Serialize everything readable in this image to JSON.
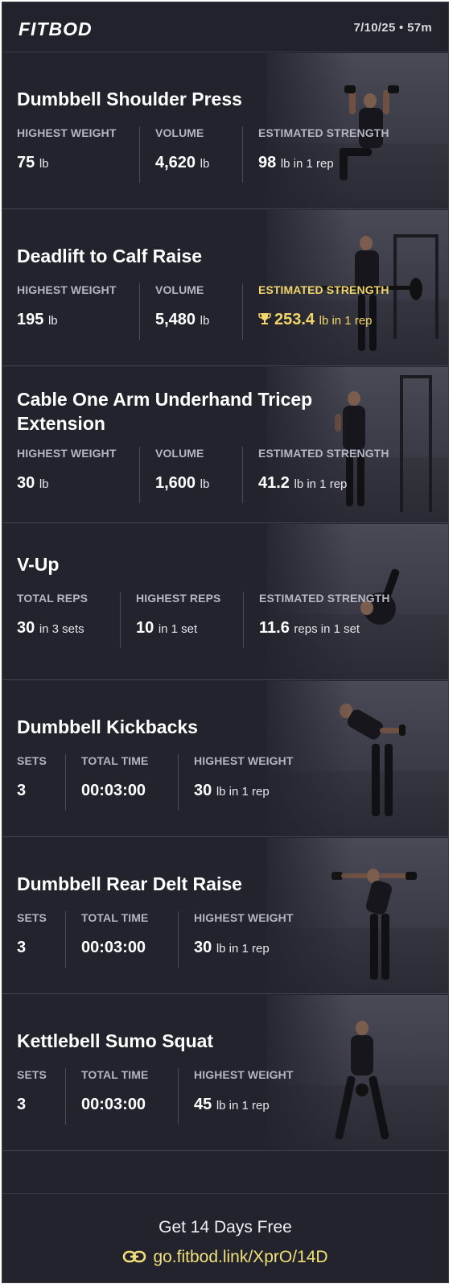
{
  "header": {
    "logo": "FITBOD",
    "meta": "7/10/25 • 57m"
  },
  "cards": [
    {
      "title": "Dumbbell Shoulder Press",
      "stats": [
        {
          "label": "HIGHEST WEIGHT",
          "value": "75",
          "unit": "lb"
        },
        {
          "label": "VOLUME",
          "value": "4,620",
          "unit": "lb"
        },
        {
          "label": "ESTIMATED STRENGTH",
          "value": "98",
          "unit": "lb in 1 rep"
        }
      ]
    },
    {
      "title": "Deadlift to Calf Raise",
      "stats": [
        {
          "label": "HIGHEST WEIGHT",
          "value": "195",
          "unit": "lb"
        },
        {
          "label": "VOLUME",
          "value": "5,480",
          "unit": "lb"
        },
        {
          "label": "ESTIMATED STRENGTH",
          "value": "253.4",
          "unit": "lb in 1 rep"
        }
      ]
    },
    {
      "title": "Cable One Arm Underhand Tricep Extension",
      "stats": [
        {
          "label": "HIGHEST WEIGHT",
          "value": "30",
          "unit": "lb"
        },
        {
          "label": "VOLUME",
          "value": "1,600",
          "unit": "lb"
        },
        {
          "label": "ESTIMATED STRENGTH",
          "value": "41.2",
          "unit": "lb in 1 rep"
        }
      ]
    },
    {
      "title": "V-Up",
      "stats": [
        {
          "label": "TOTAL REPS",
          "value": "30",
          "unit": "in 3 sets"
        },
        {
          "label": "HIGHEST REPS",
          "value": "10",
          "unit": "in 1 set"
        },
        {
          "label": "ESTIMATED STRENGTH",
          "value": "11.6",
          "unit": "reps in 1 set"
        }
      ]
    },
    {
      "title": "Dumbbell Kickbacks",
      "stats": [
        {
          "label": "SETS",
          "value": "3",
          "unit": ""
        },
        {
          "label": "TOTAL TIME",
          "value": "00:03:00",
          "unit": ""
        },
        {
          "label": "HIGHEST WEIGHT",
          "value": "30",
          "unit": "lb in 1 rep"
        }
      ]
    },
    {
      "title": "Dumbbell Rear Delt Raise",
      "stats": [
        {
          "label": "SETS",
          "value": "3",
          "unit": ""
        },
        {
          "label": "TOTAL TIME",
          "value": "00:03:00",
          "unit": ""
        },
        {
          "label": "HIGHEST WEIGHT",
          "value": "30",
          "unit": "lb in 1 rep"
        }
      ]
    },
    {
      "title": "Kettlebell Sumo Squat",
      "stats": [
        {
          "label": "SETS",
          "value": "3",
          "unit": ""
        },
        {
          "label": "TOTAL TIME",
          "value": "00:03:00",
          "unit": ""
        },
        {
          "label": "HIGHEST WEIGHT",
          "value": "45",
          "unit": "lb in 1 rep"
        }
      ]
    }
  ],
  "footer": {
    "cta": "Get 14 Days Free",
    "link": "go.fitbod.link/XprO/14D"
  },
  "icons": {
    "record": "trophy-icon",
    "link": "link-icon"
  },
  "colors": {
    "background": "#23232d",
    "accent": "#f2d66b"
  }
}
